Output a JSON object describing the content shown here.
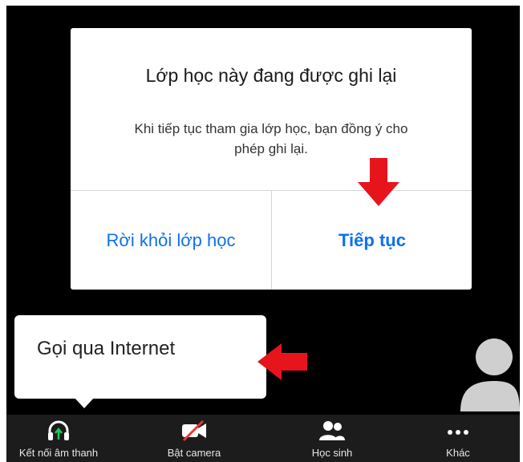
{
  "dialog": {
    "title": "Lớp học này đang được ghi lại",
    "message": "Khi tiếp tục tham gia lớp học, bạn đồng ý cho phép ghi lại.",
    "leave_label": "Rời khỏi lớp học",
    "continue_label": "Tiếp tục"
  },
  "audio_popup": {
    "option_label": "Gọi qua Internet"
  },
  "toolbar": {
    "items": [
      {
        "label": "Kết nối âm thanh",
        "icon": "headphones-icon"
      },
      {
        "label": "Bật camera",
        "icon": "camera-off-icon"
      },
      {
        "label": "Học sinh",
        "icon": "participants-icon"
      },
      {
        "label": "Khác",
        "icon": "more-icon"
      }
    ]
  },
  "colors": {
    "accent": "#0e71eb",
    "annotation_arrow": "#e8141c",
    "background": "#000000",
    "toolbar": "#1c1c1c",
    "mic_connect": "#22c55e",
    "camera_off": "#e53935"
  }
}
